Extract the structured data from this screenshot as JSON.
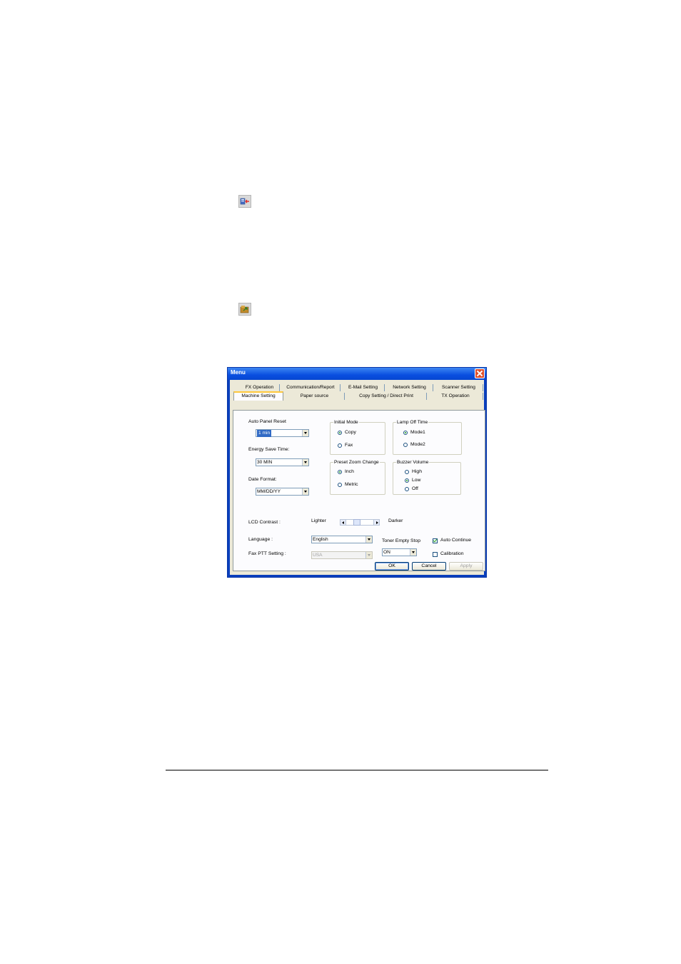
{
  "page": {
    "icons": [
      "export-icon",
      "import-icon"
    ]
  },
  "dialog": {
    "title": "Menu",
    "tabs_row1": [
      "FX Operation",
      "Communication/Report",
      "E-Mail Setting",
      "Network Setting",
      "Scanner Setting"
    ],
    "tabs_row2": [
      "Machine Setting",
      "Paper source",
      "Copy Setting / Direct Print",
      "TX Operation"
    ],
    "active_tab": "Machine Setting",
    "auto_panel_reset": {
      "label": "Auto Panel Reset",
      "value": "1 min"
    },
    "energy_save_time": {
      "label": "Energy Save Time:",
      "value": "30 MIN"
    },
    "date_format": {
      "label": "Date Format:",
      "value": "MM/DD/YY"
    },
    "initial_mode": {
      "title": "Initial Mode",
      "options": [
        "Copy",
        "Fax"
      ],
      "selected": "Copy"
    },
    "lamp_off_time": {
      "title": "Lamp Off Time",
      "options": [
        "Mode1",
        "Mode2"
      ],
      "selected": "Mode1"
    },
    "preset_zoom_change": {
      "title": "Preset Zoom Change",
      "options": [
        "Inch",
        "Metric"
      ],
      "selected": "Inch"
    },
    "buzzer_volume": {
      "title": "Buzzer Volume",
      "options": [
        "High",
        "Low",
        "Off"
      ],
      "selected": "Low"
    },
    "lcd_contrast": {
      "label": "LCD Contrast :",
      "min_label": "Lighter",
      "max_label": "Darker",
      "level": 0.4
    },
    "language": {
      "label": "Language :",
      "value": "English"
    },
    "fax_ptt_setting": {
      "label": "Fax PTT Setting :",
      "value": "USA",
      "disabled": true
    },
    "toner_empty_stop": {
      "label": "Toner Empty Stop",
      "value": "ON"
    },
    "auto_continue": {
      "label": "Auto Continue",
      "checked": true
    },
    "calibration": {
      "label": "Calibration",
      "checked": false
    },
    "buttons": {
      "ok": "OK",
      "cancel": "Cancel",
      "apply": "Apply"
    },
    "colors": {
      "titlebar": "#0a4fe0",
      "close": "#e0502c",
      "selection": "#316ac5",
      "face": "#ece9d8"
    }
  }
}
